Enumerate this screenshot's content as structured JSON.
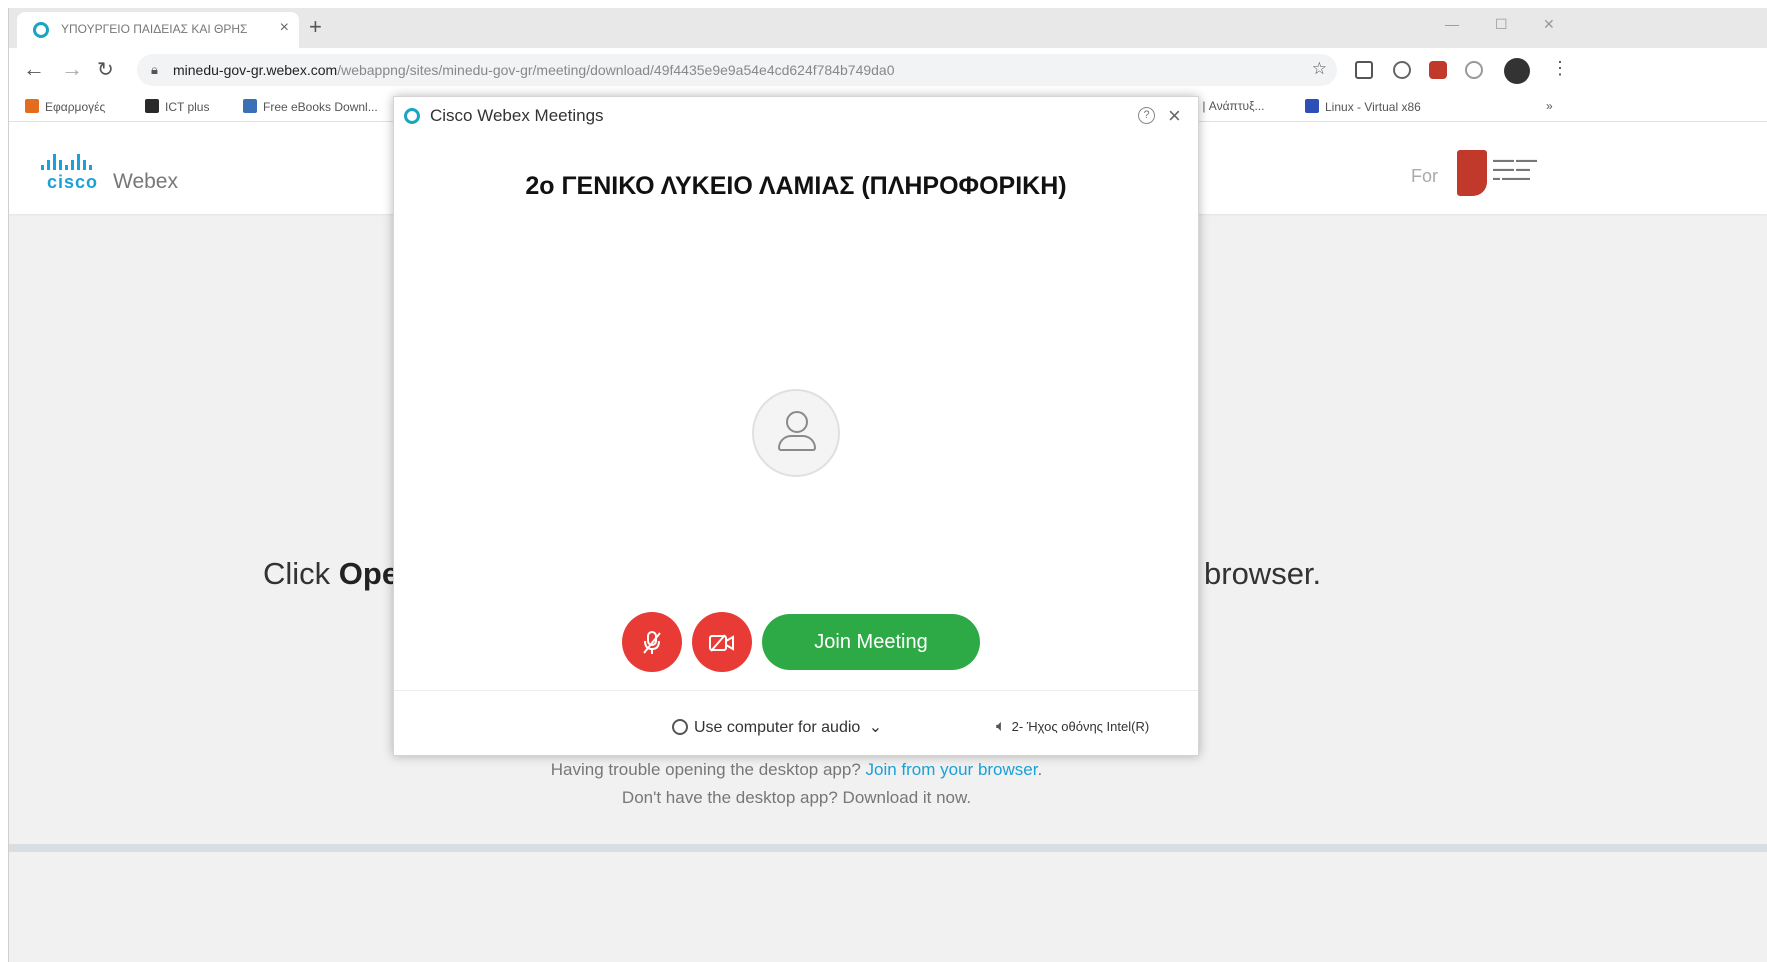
{
  "browser": {
    "tab_title": "ΥΠΟΥΡΓΕΙΟ ΠΑΙΔΕΙΑΣ ΚΑΙ ΘΡΗΣ",
    "tab_close": "×",
    "new_tab": "+",
    "url_host": "minedu-gov-gr.webex.com",
    "url_path": "/webappng/sites/minedu-gov-gr/meeting/download/49f4435e9e9a54e4cd624f784b749da0",
    "bookmarks": [
      "Εφαρμογές",
      "ICT plus",
      "Free eBooks Downl...",
      "r | Ανάπτυξ...",
      "Linux - Virtual x86"
    ]
  },
  "webex_header": {
    "cisco": "cisco",
    "webex": "Webex",
    "for_text": "For"
  },
  "page": {
    "click_prefix": "Click ",
    "click_bold": "Ope",
    "click_suffix": "browser.",
    "trouble_text": "Having trouble opening the desktop app? ",
    "trouble_link": "Join from your browser",
    "trouble_end": ".",
    "download_text": "Don't have the desktop app? Download it now."
  },
  "dialog": {
    "title": "Cisco Webex Meetings",
    "help": "?",
    "close": "×",
    "meeting_name": "2ο ΓΕΝΙΚΟ ΛΥΚΕΙΟ ΛΑΜΙΑΣ (ΠΛΗΡΟΦΟΡΙΚΗ)",
    "join_label": "Join Meeting",
    "audio_option": "Use computer for audio",
    "speaker_device": "2- Ήχος οθόνης Intel(R)"
  },
  "colors": {
    "accent": "#1ba0d7",
    "join_green": "#2daa45",
    "mute_red": "#e83b36"
  }
}
